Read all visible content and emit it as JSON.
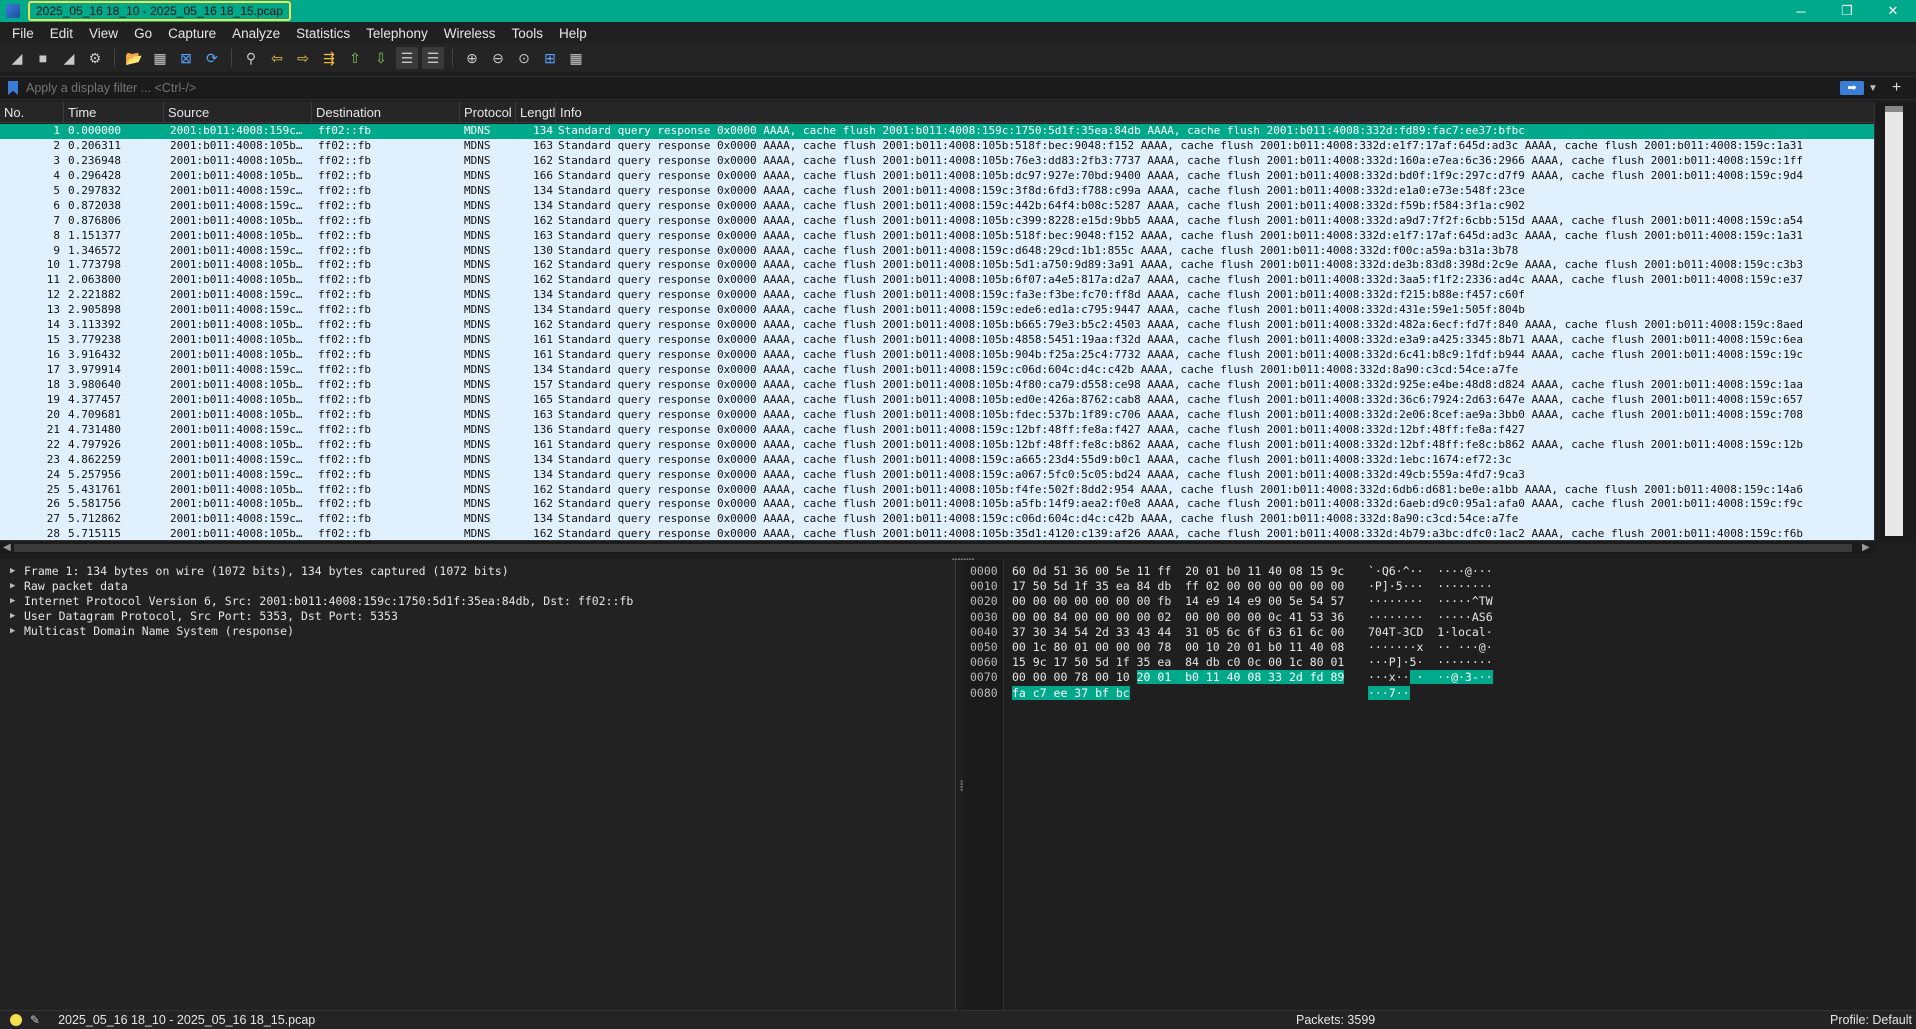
{
  "window": {
    "title": "2025_05_16 18_10 - 2025_05_16 18_15.pcap",
    "minimize": "─",
    "restore": "❐",
    "close": "✕"
  },
  "menu": [
    "File",
    "Edit",
    "View",
    "Go",
    "Capture",
    "Analyze",
    "Statistics",
    "Telephony",
    "Wireless",
    "Tools",
    "Help"
  ],
  "toolbar": [
    {
      "name": "start-capture-icon",
      "glyph": "◢",
      "cls": ""
    },
    {
      "name": "stop-capture-icon",
      "glyph": "■",
      "cls": ""
    },
    {
      "name": "restart-capture-icon",
      "glyph": "◢",
      "cls": ""
    },
    {
      "name": "capture-options-icon",
      "glyph": "⚙",
      "cls": ""
    },
    {
      "name": "sep",
      "glyph": "",
      "cls": "sep"
    },
    {
      "name": "open-file-icon",
      "glyph": "📂",
      "cls": "accent"
    },
    {
      "name": "save-file-icon",
      "glyph": "▦",
      "cls": ""
    },
    {
      "name": "close-file-icon",
      "glyph": "⊠",
      "cls": "blue"
    },
    {
      "name": "reload-file-icon",
      "glyph": "⟳",
      "cls": "blue"
    },
    {
      "name": "sep",
      "glyph": "",
      "cls": "sep"
    },
    {
      "name": "find-packet-icon",
      "glyph": "⚲",
      "cls": ""
    },
    {
      "name": "go-back-icon",
      "glyph": "⇦",
      "cls": "accent"
    },
    {
      "name": "go-forward-icon",
      "glyph": "⇨",
      "cls": "accent"
    },
    {
      "name": "go-to-packet-icon",
      "glyph": "⇶",
      "cls": "accent"
    },
    {
      "name": "go-first-packet-icon",
      "glyph": "⇧",
      "cls": "green"
    },
    {
      "name": "go-last-packet-icon",
      "glyph": "⇩",
      "cls": "green"
    },
    {
      "name": "auto-scroll-icon",
      "glyph": "☰",
      "cls": "box"
    },
    {
      "name": "colorize-icon",
      "glyph": "☰",
      "cls": "box"
    },
    {
      "name": "sep",
      "glyph": "",
      "cls": "sep"
    },
    {
      "name": "zoom-in-icon",
      "glyph": "⊕",
      "cls": ""
    },
    {
      "name": "zoom-out-icon",
      "glyph": "⊖",
      "cls": ""
    },
    {
      "name": "zoom-normal-icon",
      "glyph": "⊙",
      "cls": ""
    },
    {
      "name": "resize-columns-icon",
      "glyph": "⊞",
      "cls": "blue"
    },
    {
      "name": "grid-icon",
      "glyph": "▦",
      "cls": ""
    }
  ],
  "filter": {
    "placeholder": "Apply a display filter ... <Ctrl-/>",
    "apply": "➡",
    "dropdown": "▼",
    "add": "+"
  },
  "columns": {
    "no": "No.",
    "time": "Time",
    "source": "Source",
    "destination": "Destination",
    "protocol": "Protocol",
    "length": "Lengtl",
    "info": "Info"
  },
  "packets": [
    {
      "no": "1",
      "time": "0.000000",
      "src": "2001:b011:4008:159c…",
      "dst": "ff02::fb",
      "proto": "MDNS",
      "len": "134",
      "info": "Standard query response 0x0000 AAAA, cache flush 2001:b011:4008:159c:1750:5d1f:35ea:84db AAAA, cache flush 2001:b011:4008:332d:fd89:fac7:ee37:bfbc"
    },
    {
      "no": "2",
      "time": "0.206311",
      "src": "2001:b011:4008:105b…",
      "dst": "ff02::fb",
      "proto": "MDNS",
      "len": "163",
      "info": "Standard query response 0x0000 AAAA, cache flush 2001:b011:4008:105b:518f:bec:9048:f152 AAAA, cache flush 2001:b011:4008:332d:e1f7:17af:645d:ad3c AAAA, cache flush 2001:b011:4008:159c:1a31"
    },
    {
      "no": "3",
      "time": "0.236948",
      "src": "2001:b011:4008:105b…",
      "dst": "ff02::fb",
      "proto": "MDNS",
      "len": "162",
      "info": "Standard query response 0x0000 AAAA, cache flush 2001:b011:4008:105b:76e3:dd83:2fb3:7737 AAAA, cache flush 2001:b011:4008:332d:160a:e7ea:6c36:2966 AAAA, cache flush 2001:b011:4008:159c:1ff"
    },
    {
      "no": "4",
      "time": "0.296428",
      "src": "2001:b011:4008:105b…",
      "dst": "ff02::fb",
      "proto": "MDNS",
      "len": "166",
      "info": "Standard query response 0x0000 AAAA, cache flush 2001:b011:4008:105b:dc97:927e:70bd:9400 AAAA, cache flush 2001:b011:4008:332d:bd0f:1f9c:297c:d7f9 AAAA, cache flush 2001:b011:4008:159c:9d4"
    },
    {
      "no": "5",
      "time": "0.297832",
      "src": "2001:b011:4008:159c…",
      "dst": "ff02::fb",
      "proto": "MDNS",
      "len": "134",
      "info": "Standard query response 0x0000 AAAA, cache flush 2001:b011:4008:159c:3f8d:6fd3:f788:c99a AAAA, cache flush 2001:b011:4008:332d:e1a0:e73e:548f:23ce"
    },
    {
      "no": "6",
      "time": "0.872038",
      "src": "2001:b011:4008:159c…",
      "dst": "ff02::fb",
      "proto": "MDNS",
      "len": "134",
      "info": "Standard query response 0x0000 AAAA, cache flush 2001:b011:4008:159c:442b:64f4:b08c:5287 AAAA, cache flush 2001:b011:4008:332d:f59b:f584:3f1a:c902"
    },
    {
      "no": "7",
      "time": "0.876806",
      "src": "2001:b011:4008:105b…",
      "dst": "ff02::fb",
      "proto": "MDNS",
      "len": "162",
      "info": "Standard query response 0x0000 AAAA, cache flush 2001:b011:4008:105b:c399:8228:e15d:9bb5 AAAA, cache flush 2001:b011:4008:332d:a9d7:7f2f:6cbb:515d AAAA, cache flush 2001:b011:4008:159c:a54"
    },
    {
      "no": "8",
      "time": "1.151377",
      "src": "2001:b011:4008:105b…",
      "dst": "ff02::fb",
      "proto": "MDNS",
      "len": "163",
      "info": "Standard query response 0x0000 AAAA, cache flush 2001:b011:4008:105b:518f:bec:9048:f152 AAAA, cache flush 2001:b011:4008:332d:e1f7:17af:645d:ad3c AAAA, cache flush 2001:b011:4008:159c:1a31"
    },
    {
      "no": "9",
      "time": "1.346572",
      "src": "2001:b011:4008:159c…",
      "dst": "ff02::fb",
      "proto": "MDNS",
      "len": "130",
      "info": "Standard query response 0x0000 AAAA, cache flush 2001:b011:4008:159c:d648:29cd:1b1:855c AAAA, cache flush 2001:b011:4008:332d:f00c:a59a:b31a:3b78"
    },
    {
      "no": "10",
      "time": "1.773798",
      "src": "2001:b011:4008:105b…",
      "dst": "ff02::fb",
      "proto": "MDNS",
      "len": "162",
      "info": "Standard query response 0x0000 AAAA, cache flush 2001:b011:4008:105b:5d1:a750:9d89:3a91 AAAA, cache flush 2001:b011:4008:332d:de3b:83d8:398d:2c9e AAAA, cache flush 2001:b011:4008:159c:c3b3"
    },
    {
      "no": "11",
      "time": "2.063800",
      "src": "2001:b011:4008:105b…",
      "dst": "ff02::fb",
      "proto": "MDNS",
      "len": "162",
      "info": "Standard query response 0x0000 AAAA, cache flush 2001:b011:4008:105b:6f07:a4e5:817a:d2a7 AAAA, cache flush 2001:b011:4008:332d:3aa5:f1f2:2336:ad4c AAAA, cache flush 2001:b011:4008:159c:e37"
    },
    {
      "no": "12",
      "time": "2.221882",
      "src": "2001:b011:4008:159c…",
      "dst": "ff02::fb",
      "proto": "MDNS",
      "len": "134",
      "info": "Standard query response 0x0000 AAAA, cache flush 2001:b011:4008:159c:fa3e:f3be:fc70:ff8d AAAA, cache flush 2001:b011:4008:332d:f215:b88e:f457:c60f"
    },
    {
      "no": "13",
      "time": "2.905898",
      "src": "2001:b011:4008:159c…",
      "dst": "ff02::fb",
      "proto": "MDNS",
      "len": "134",
      "info": "Standard query response 0x0000 AAAA, cache flush 2001:b011:4008:159c:ede6:ed1a:c795:9447 AAAA, cache flush 2001:b011:4008:332d:431e:59e1:505f:804b"
    },
    {
      "no": "14",
      "time": "3.113392",
      "src": "2001:b011:4008:105b…",
      "dst": "ff02::fb",
      "proto": "MDNS",
      "len": "162",
      "info": "Standard query response 0x0000 AAAA, cache flush 2001:b011:4008:105b:b665:79e3:b5c2:4503 AAAA, cache flush 2001:b011:4008:332d:482a:6ecf:fd7f:840 AAAA, cache flush 2001:b011:4008:159c:8aed"
    },
    {
      "no": "15",
      "time": "3.779238",
      "src": "2001:b011:4008:105b…",
      "dst": "ff02::fb",
      "proto": "MDNS",
      "len": "161",
      "info": "Standard query response 0x0000 AAAA, cache flush 2001:b011:4008:105b:4858:5451:19aa:f32d AAAA, cache flush 2001:b011:4008:332d:e3a9:a425:3345:8b71 AAAA, cache flush 2001:b011:4008:159c:6ea"
    },
    {
      "no": "16",
      "time": "3.916432",
      "src": "2001:b011:4008:105b…",
      "dst": "ff02::fb",
      "proto": "MDNS",
      "len": "161",
      "info": "Standard query response 0x0000 AAAA, cache flush 2001:b011:4008:105b:904b:f25a:25c4:7732 AAAA, cache flush 2001:b011:4008:332d:6c41:b8c9:1fdf:b944 AAAA, cache flush 2001:b011:4008:159c:19c"
    },
    {
      "no": "17",
      "time": "3.979914",
      "src": "2001:b011:4008:159c…",
      "dst": "ff02::fb",
      "proto": "MDNS",
      "len": "134",
      "info": "Standard query response 0x0000 AAAA, cache flush 2001:b011:4008:159c:c06d:604c:d4c:c42b AAAA, cache flush 2001:b011:4008:332d:8a90:c3cd:54ce:a7fe"
    },
    {
      "no": "18",
      "time": "3.980640",
      "src": "2001:b011:4008:105b…",
      "dst": "ff02::fb",
      "proto": "MDNS",
      "len": "157",
      "info": "Standard query response 0x0000 AAAA, cache flush 2001:b011:4008:105b:4f80:ca79:d558:ce98 AAAA, cache flush 2001:b011:4008:332d:925e:e4be:48d8:d824 AAAA, cache flush 2001:b011:4008:159c:1aa"
    },
    {
      "no": "19",
      "time": "4.377457",
      "src": "2001:b011:4008:105b…",
      "dst": "ff02::fb",
      "proto": "MDNS",
      "len": "165",
      "info": "Standard query response 0x0000 AAAA, cache flush 2001:b011:4008:105b:ed0e:426a:8762:cab8 AAAA, cache flush 2001:b011:4008:332d:36c6:7924:2d63:647e AAAA, cache flush 2001:b011:4008:159c:657"
    },
    {
      "no": "20",
      "time": "4.709681",
      "src": "2001:b011:4008:105b…",
      "dst": "ff02::fb",
      "proto": "MDNS",
      "len": "163",
      "info": "Standard query response 0x0000 AAAA, cache flush 2001:b011:4008:105b:fdec:537b:1f89:c706 AAAA, cache flush 2001:b011:4008:332d:2e06:8cef:ae9a:3bb0 AAAA, cache flush 2001:b011:4008:159c:708"
    },
    {
      "no": "21",
      "time": "4.731480",
      "src": "2001:b011:4008:159c…",
      "dst": "ff02::fb",
      "proto": "MDNS",
      "len": "136",
      "info": "Standard query response 0x0000 AAAA, cache flush 2001:b011:4008:159c:12bf:48ff:fe8a:f427 AAAA, cache flush 2001:b011:4008:332d:12bf:48ff:fe8a:f427"
    },
    {
      "no": "22",
      "time": "4.797926",
      "src": "2001:b011:4008:105b…",
      "dst": "ff02::fb",
      "proto": "MDNS",
      "len": "161",
      "info": "Standard query response 0x0000 AAAA, cache flush 2001:b011:4008:105b:12bf:48ff:fe8c:b862 AAAA, cache flush 2001:b011:4008:332d:12bf:48ff:fe8c:b862 AAAA, cache flush 2001:b011:4008:159c:12b"
    },
    {
      "no": "23",
      "time": "4.862259",
      "src": "2001:b011:4008:159c…",
      "dst": "ff02::fb",
      "proto": "MDNS",
      "len": "134",
      "info": "Standard query response 0x0000 AAAA, cache flush 2001:b011:4008:159c:a665:23d4:55d9:b0c1 AAAA, cache flush 2001:b011:4008:332d:1ebc:1674:ef72:3c"
    },
    {
      "no": "24",
      "time": "5.257956",
      "src": "2001:b011:4008:159c…",
      "dst": "ff02::fb",
      "proto": "MDNS",
      "len": "134",
      "info": "Standard query response 0x0000 AAAA, cache flush 2001:b011:4008:159c:a067:5fc0:5c05:bd24 AAAA, cache flush 2001:b011:4008:332d:49cb:559a:4fd7:9ca3"
    },
    {
      "no": "25",
      "time": "5.431761",
      "src": "2001:b011:4008:105b…",
      "dst": "ff02::fb",
      "proto": "MDNS",
      "len": "162",
      "info": "Standard query response 0x0000 AAAA, cache flush 2001:b011:4008:105b:f4fe:502f:8dd2:954 AAAA, cache flush 2001:b011:4008:332d:6db6:d681:be0e:a1bb AAAA, cache flush 2001:b011:4008:159c:14a6"
    },
    {
      "no": "26",
      "time": "5.581756",
      "src": "2001:b011:4008:105b…",
      "dst": "ff02::fb",
      "proto": "MDNS",
      "len": "162",
      "info": "Standard query response 0x0000 AAAA, cache flush 2001:b011:4008:105b:a5fb:14f9:aea2:f0e8 AAAA, cache flush 2001:b011:4008:332d:6aeb:d9c0:95a1:afa0 AAAA, cache flush 2001:b011:4008:159c:f9c"
    },
    {
      "no": "27",
      "time": "5.712862",
      "src": "2001:b011:4008:159c…",
      "dst": "ff02::fb",
      "proto": "MDNS",
      "len": "134",
      "info": "Standard query response 0x0000 AAAA, cache flush 2001:b011:4008:159c:c06d:604c:d4c:c42b AAAA, cache flush 2001:b011:4008:332d:8a90:c3cd:54ce:a7fe"
    },
    {
      "no": "28",
      "time": "5.715115",
      "src": "2001:b011:4008:105b…",
      "dst": "ff02::fb",
      "proto": "MDNS",
      "len": "162",
      "info": "Standard query response 0x0000 AAAA, cache flush 2001:b011:4008:105b:35d1:4120:c139:af26 AAAA, cache flush 2001:b011:4008:332d:4b79:a3bc:dfc0:1ac2 AAAA, cache flush 2001:b011:4008:159c:f6b"
    }
  ],
  "details": [
    "Frame 1: 134 bytes on wire (1072 bits), 134 bytes captured (1072 bits)",
    "Raw packet data",
    "Internet Protocol Version 6, Src: 2001:b011:4008:159c:1750:5d1f:35ea:84db, Dst: ff02::fb",
    "User Datagram Protocol, Src Port: 5353, Dst Port: 5353",
    "Multicast Domain Name System (response)"
  ],
  "bytes": [
    {
      "off": "0000",
      "hex": "60 0d 51 36 00 5e 11 ff  20 01 b0 11 40 08 15 9c",
      "hex_hl": "",
      "asc": "`·Q6·^··  ····@···",
      "asc_hl": ""
    },
    {
      "off": "0010",
      "hex": "17 50 5d 1f 35 ea 84 db  ff 02 00 00 00 00 00 00",
      "hex_hl": "",
      "asc": "·P]·5···  ········",
      "asc_hl": ""
    },
    {
      "off": "0020",
      "hex": "00 00 00 00 00 00 00 fb  14 e9 14 e9 00 5e 54 57",
      "hex_hl": "",
      "asc": "········  ·····^TW",
      "asc_hl": ""
    },
    {
      "off": "0030",
      "hex": "00 00 84 00 00 00 00 02  00 00 00 00 0c 41 53 36",
      "hex_hl": "",
      "asc": "········  ·····AS6",
      "asc_hl": ""
    },
    {
      "off": "0040",
      "hex": "37 30 34 54 2d 33 43 44  31 05 6c 6f 63 61 6c 00",
      "hex_hl": "",
      "asc": "704T-3CD  1·local·",
      "asc_hl": ""
    },
    {
      "off": "0050",
      "hex": "00 1c 80 01 00 00 00 78  00 10 20 01 b0 11 40 08",
      "hex_hl": "",
      "asc": "·······x  ·· ···@·",
      "asc_hl": ""
    },
    {
      "off": "0060",
      "hex": "15 9c 17 50 5d 1f 35 ea  84 db c0 0c 00 1c 80 01",
      "hex_hl": "",
      "asc": "···P]·5·  ········",
      "asc_hl": ""
    },
    {
      "off": "0070",
      "hex": "00 00 00 78 00 10 ",
      "hex_hl": "20 01  b0 11 40 08 33 2d fd 89",
      "asc": "···x··",
      "asc_hl": " ·  ··@·3-··"
    },
    {
      "off": "0080",
      "hex": "",
      "hex_hl": "fa c7 ee 37 bf bc",
      "asc": "",
      "asc_hl": "···7··"
    }
  ],
  "status": {
    "file": "2025_05_16 18_10 - 2025_05_16 18_15.pcap",
    "packets": "Packets: 3599",
    "profile": "Profile: Default"
  }
}
